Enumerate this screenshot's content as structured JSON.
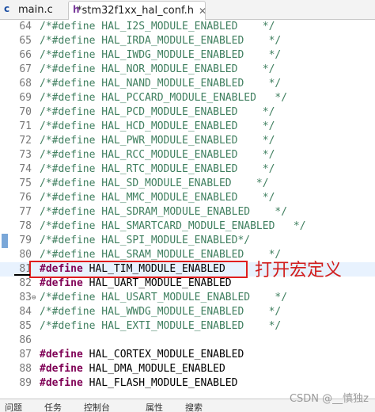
{
  "tabs": [
    {
      "label": "main.c",
      "icon": "c-file-icon",
      "active": false
    },
    {
      "label": "*stm32f1xx_hal_conf.h",
      "icon": "h-file-icon",
      "active": true
    }
  ],
  "close_glyph": "✕",
  "lines": [
    {
      "num": "64",
      "code": "/*#define HAL_I2S_MODULE_ENABLED    */"
    },
    {
      "num": "65",
      "code": "/*#define HAL_IRDA_MODULE_ENABLED    */"
    },
    {
      "num": "66",
      "code": "/*#define HAL_IWDG_MODULE_ENABLED    */"
    },
    {
      "num": "67",
      "code": "/*#define HAL_NOR_MODULE_ENABLED    */"
    },
    {
      "num": "68",
      "code": "/*#define HAL_NAND_MODULE_ENABLED    */"
    },
    {
      "num": "69",
      "code": "/*#define HAL_PCCARD_MODULE_ENABLED   */"
    },
    {
      "num": "70",
      "code": "/*#define HAL_PCD_MODULE_ENABLED    */"
    },
    {
      "num": "71",
      "code": "/*#define HAL_HCD_MODULE_ENABLED    */"
    },
    {
      "num": "72",
      "code": "/*#define HAL_PWR_MODULE_ENABLED    */"
    },
    {
      "num": "73",
      "code": "/*#define HAL_RCC_MODULE_ENABLED    */"
    },
    {
      "num": "74",
      "code": "/*#define HAL_RTC_MODULE_ENABLED    */"
    },
    {
      "num": "75",
      "code": "/*#define HAL_SD_MODULE_ENABLED    */"
    },
    {
      "num": "76",
      "code": "/*#define HAL_MMC_MODULE_ENABLED    */"
    },
    {
      "num": "77",
      "code": "/*#define HAL_SDRAM_MODULE_ENABLED    */"
    },
    {
      "num": "78",
      "code": "/*#define HAL_SMARTCARD_MODULE_ENABLED   */"
    },
    {
      "num": "79",
      "code": "/*#define HAL_SPI_MODULE_ENABLED*/"
    },
    {
      "num": "80",
      "code": "/*#define HAL_SRAM_MODULE_ENABLED    */"
    },
    {
      "num": "81",
      "code": "#define HAL_TIM_MODULE_ENABLED"
    },
    {
      "num": "82",
      "code": "#define HAL_UART_MODULE_ENABLED"
    },
    {
      "num": "83",
      "code": "/*#define HAL_USART_MODULE_ENABLED    */"
    },
    {
      "num": "84",
      "code": "/*#define HAL_WWDG_MODULE_ENABLED    */"
    },
    {
      "num": "85",
      "code": "/*#define HAL_EXTI_MODULE_ENABLED    */"
    },
    {
      "num": "86",
      "code": ""
    },
    {
      "num": "87",
      "code": "#define HAL_CORTEX_MODULE_ENABLED"
    },
    {
      "num": "88",
      "code": "#define HAL_DMA_MODULE_ENABLED"
    },
    {
      "num": "89",
      "code": "#define HAL_FLASH_MODULE_ENABLED"
    }
  ],
  "annotation": "打开宏定义",
  "bottom_tabs": [
    "问题",
    "任务",
    "控制台",
    "属性",
    "搜索"
  ],
  "watermark": "CSDN @__慎独z",
  "colors": {
    "keyword": "#7f0055",
    "comment": "#3f7f5f",
    "annotation": "#d11c1c",
    "current_line": "#e8f2fe"
  }
}
